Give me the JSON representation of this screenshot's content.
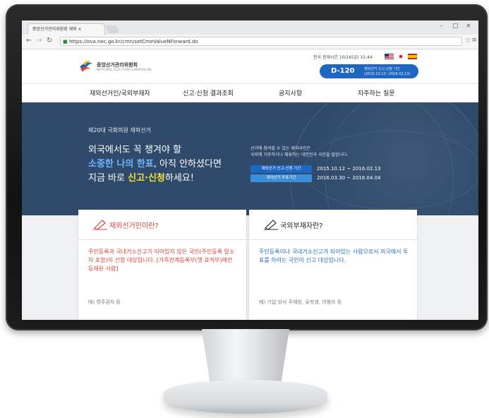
{
  "browser": {
    "tab_title": "중앙선거관리위원회 재외 ×",
    "tab_close": "×",
    "address": "https://ova.nec.go.kr/cmn/setCmeValueNForward.do",
    "window_min": "–",
    "window_max": "□",
    "window_close": "×"
  },
  "site": {
    "logo_name": "중앙선거관리위원회",
    "logo_sub": "NATIONAL ELECTION COMMISSION",
    "clock": "한국 현재시간 10/16(금) 15:44",
    "dday": {
      "count": "D-120",
      "line1": "재외선거 신고·신청 기간",
      "line2": "(2015.10.12~2016.02.13)"
    },
    "nav": [
      "재외선거인/국외부재자",
      "신고·신청 결과조회",
      "공지사항",
      "자주하는 질문"
    ]
  },
  "hero": {
    "kicker": "제20대 국회의원 재외선거",
    "line1": "외국에서도 꼭 챙겨야 할",
    "line2": {
      "blue": "소중한 나의 한표",
      "rest": ", 아직 안하셨다면"
    },
    "line3": {
      "pre": "지금 바로 ",
      "yellow": "신고·신청",
      "post": "하세요!"
    },
    "info1": "선거에 참여할 수 있는 재외국민은",
    "info2": "국외에 거주하거나 체류하는 대한민국 국민을 말합니다.",
    "periods": [
      {
        "label": "재외선거 신고·신청 기간",
        "date": "2015.10.12 ~ 2016.02.13",
        "color": "#1f66c2"
      },
      {
        "label": "재외선거 투표기간",
        "date": "2016.03.30 ~ 2016.04.04",
        "color": "#3b8fd9"
      }
    ]
  },
  "cards": [
    {
      "title": "재외선거인이란?",
      "color": "#d9453c",
      "body": "주민등록과 국내거소신고가 되어있지 않은 국민(주민등록 말소자 포함)이 신청 대상입니다. [가족관계등록부(옛 호적부)에만 등재된 사람]",
      "example": "예) 영주권자 등",
      "icon": "pencil-icon"
    },
    {
      "title": "국외부재자란?",
      "color": "#2c6fb8",
      "body": "주민등록이나 국내거소신고가 되어있는 사람으로서 외국에서 투표를 하려는 국민이 신고 대상입니다.",
      "example": "예) 기업·상사 주재원, 유학생, 여행자 등",
      "icon": "pencil-icon"
    }
  ]
}
